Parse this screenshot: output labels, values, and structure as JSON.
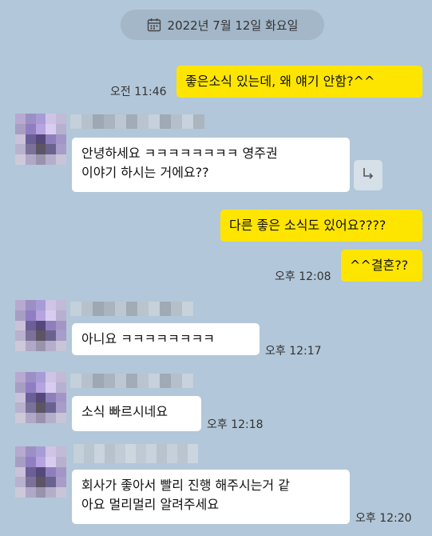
{
  "date_divider": {
    "label": "2022년 7월 12일 화요일",
    "icon": "calendar-icon"
  },
  "messages": [
    {
      "side": "me",
      "text": "좋은소식 있는데, 왜 얘기 안함?^^",
      "time": "오전 11:46"
    },
    {
      "side": "them",
      "lines": [
        "안녕하세요 ㅋㅋㅋㅋㅋㅋㅋㅋ 영주권",
        "이야기 하시는 거에요??"
      ],
      "time": ""
    },
    {
      "side": "me",
      "text": "다른 좋은 소식도 있어요????",
      "time": ""
    },
    {
      "side": "me",
      "text": "^^결혼??",
      "time": "오후 12:08"
    },
    {
      "side": "them",
      "text": "아니요 ㅋㅋㅋㅋㅋㅋㅋㅋ",
      "time": "오후 12:17"
    },
    {
      "side": "them",
      "text": "소식 빠르시네요",
      "time": "오후 12:18"
    },
    {
      "side": "them",
      "lines": [
        "회사가 좋아서 빨리 진행 해주시는거 같",
        "아요 멀리멀리 알려주세요"
      ],
      "time": "오후 12:20"
    }
  ],
  "share_icon": "share-arrow-icon",
  "colors": {
    "background": "#b2c7d9",
    "my_bubble": "#fee500",
    "their_bubble": "#ffffff",
    "date_pill": "#a3b7c9"
  }
}
